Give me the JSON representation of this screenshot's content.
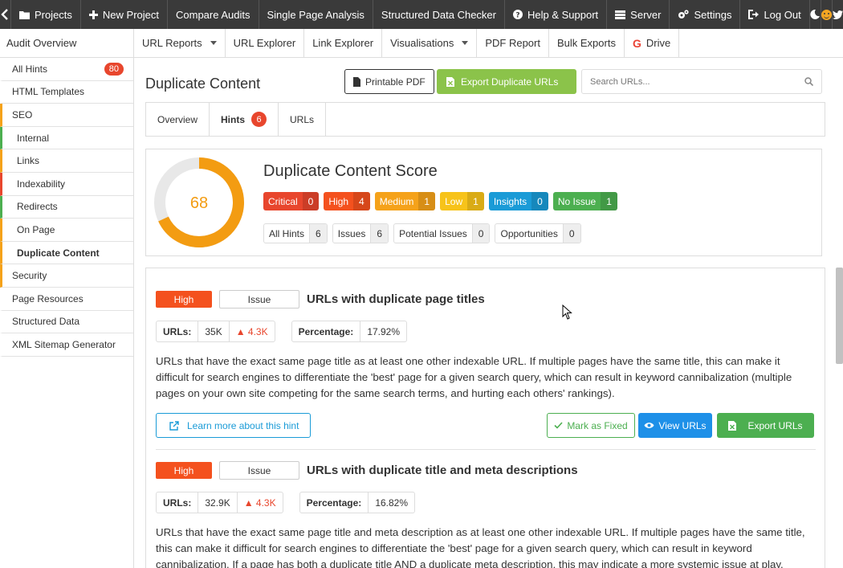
{
  "topnav": {
    "items": [
      {
        "label": "Projects",
        "icon": "folder-icon"
      },
      {
        "label": "New Project",
        "icon": "plus-icon"
      },
      {
        "label": "Compare Audits"
      },
      {
        "label": "Single Page Analysis"
      },
      {
        "label": "Structured Data Checker"
      },
      {
        "label": "Help & Support",
        "icon": "question-circle-icon"
      },
      {
        "label": "Server",
        "icon": "server-icon"
      },
      {
        "label": "Settings",
        "icon": "gears-icon"
      },
      {
        "label": "Log Out",
        "icon": "sign-out-icon"
      }
    ]
  },
  "subnav": {
    "audit_overview": "Audit Overview",
    "items": [
      "URL Reports",
      "URL Explorer",
      "Link Explorer",
      "Visualisations",
      "PDF Report",
      "Bulk Exports",
      "Drive"
    ]
  },
  "sidebar": {
    "items": [
      {
        "label": "All Hints",
        "badge": "80"
      },
      {
        "label": "HTML Templates"
      },
      {
        "label": "SEO"
      },
      {
        "label": "Internal"
      },
      {
        "label": "Links"
      },
      {
        "label": "Indexability"
      },
      {
        "label": "Redirects"
      },
      {
        "label": "On Page"
      },
      {
        "label": "Duplicate Content"
      },
      {
        "label": "Security"
      },
      {
        "label": "Page Resources"
      },
      {
        "label": "Structured Data"
      },
      {
        "label": "XML Sitemap Generator"
      }
    ]
  },
  "main": {
    "title": "Duplicate Content",
    "printable_pdf": "Printable PDF",
    "export_button": "Export Duplicate URLs",
    "search_placeholder": "Search URLs...",
    "tabs": [
      {
        "label": "Overview"
      },
      {
        "label": "Hints",
        "badge": "6"
      },
      {
        "label": "URLs"
      }
    ]
  },
  "score": {
    "title": "Duplicate Content Score",
    "value": "68",
    "fraction": 0.68,
    "colors": {
      "ring": "#f39c12",
      "track": "#e8e8e8"
    },
    "severities": [
      {
        "label": "Critical",
        "count": "0",
        "color": "#e8462d"
      },
      {
        "label": "High",
        "count": "4",
        "color": "#f4511e"
      },
      {
        "label": "Medium",
        "count": "1",
        "color": "#f5a21a"
      },
      {
        "label": "Low",
        "count": "1",
        "color": "#f7c31a"
      },
      {
        "label": "Insights",
        "count": "0",
        "color": "#1a9bd7"
      },
      {
        "label": "No Issue",
        "count": "1",
        "color": "#4caf50"
      }
    ],
    "hint_types": [
      {
        "label": "All Hints",
        "count": "6"
      },
      {
        "label": "Issues",
        "count": "6"
      },
      {
        "label": "Potential Issues",
        "count": "0"
      },
      {
        "label": "Opportunities",
        "count": "0"
      }
    ]
  },
  "hints": [
    {
      "severity": "High",
      "type": "Issue",
      "title": "URLs with duplicate page titles",
      "urls_label": "URLs:",
      "urls_count": "35K",
      "urls_change": "4.3K",
      "percentage_label": "Percentage:",
      "percentage": "17.92%",
      "description": "URLs that have the exact same page title as at least one other indexable URL. If multiple pages have the same title, this can make it difficult for search engines to differentiate the 'best' page for a given search query, which can result in keyword cannibalization (multiple pages on your own site competing for the same search terms, and hurting each others' rankings).",
      "learn_more": "Learn more about this hint",
      "mark_fixed": "Mark as Fixed",
      "view_urls": "View URLs",
      "export_urls": "Export URLs"
    },
    {
      "severity": "High",
      "type": "Issue",
      "title": "URLs with duplicate title and meta descriptions",
      "urls_label": "URLs:",
      "urls_count": "32.9K",
      "urls_change": "4.3K",
      "percentage_label": "Percentage:",
      "percentage": "16.82%",
      "description": "URLs that have the exact same page title and meta description as at least one other indexable URL. If multiple pages have the same title, this can make it difficult for search engines to differentiate the 'best' page for a given search query, which can result in keyword cannibalization. If a page has both a duplicate title AND a duplicate meta description, this may indicate a more systemic issue at play."
    }
  ]
}
